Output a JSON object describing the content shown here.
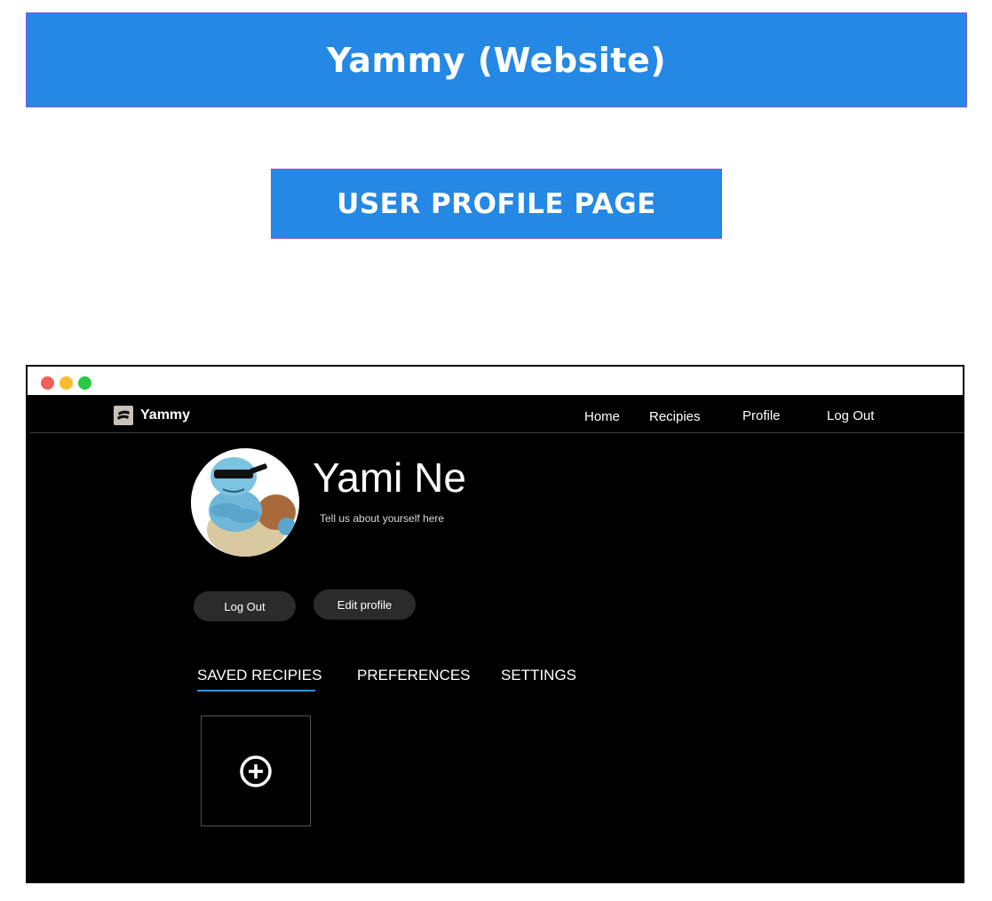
{
  "header": {
    "title": "Yammy (Website)",
    "subtitle": "USER PROFILE PAGE"
  },
  "window": {
    "traffic_lights": [
      "#f25f58",
      "#f7bd2f",
      "#28c840"
    ]
  },
  "navbar": {
    "brand_name": "Yammy",
    "brand_icon": "logo-icon",
    "items": [
      {
        "label": "Home"
      },
      {
        "label": "Recipies"
      },
      {
        "label": "Profile"
      },
      {
        "label": "Log Out"
      }
    ]
  },
  "profile": {
    "name": "Yami Ne",
    "bio": "Tell us about yourself here",
    "avatar_icon": "avatar-image"
  },
  "actions": {
    "logout_label": "Log Out",
    "edit_label": "Edit profile"
  },
  "tabs": [
    {
      "label": "SAVED RECIPIES",
      "active": true
    },
    {
      "label": "PREFERENCES",
      "active": false
    },
    {
      "label": "SETTINGS",
      "active": false
    }
  ],
  "saved_recipes": {
    "add_icon": "plus-circle-icon"
  },
  "colors": {
    "banner": "#2488e4",
    "accent": "#3a92e0",
    "background": "#000000",
    "button": "#2b2b2b"
  }
}
